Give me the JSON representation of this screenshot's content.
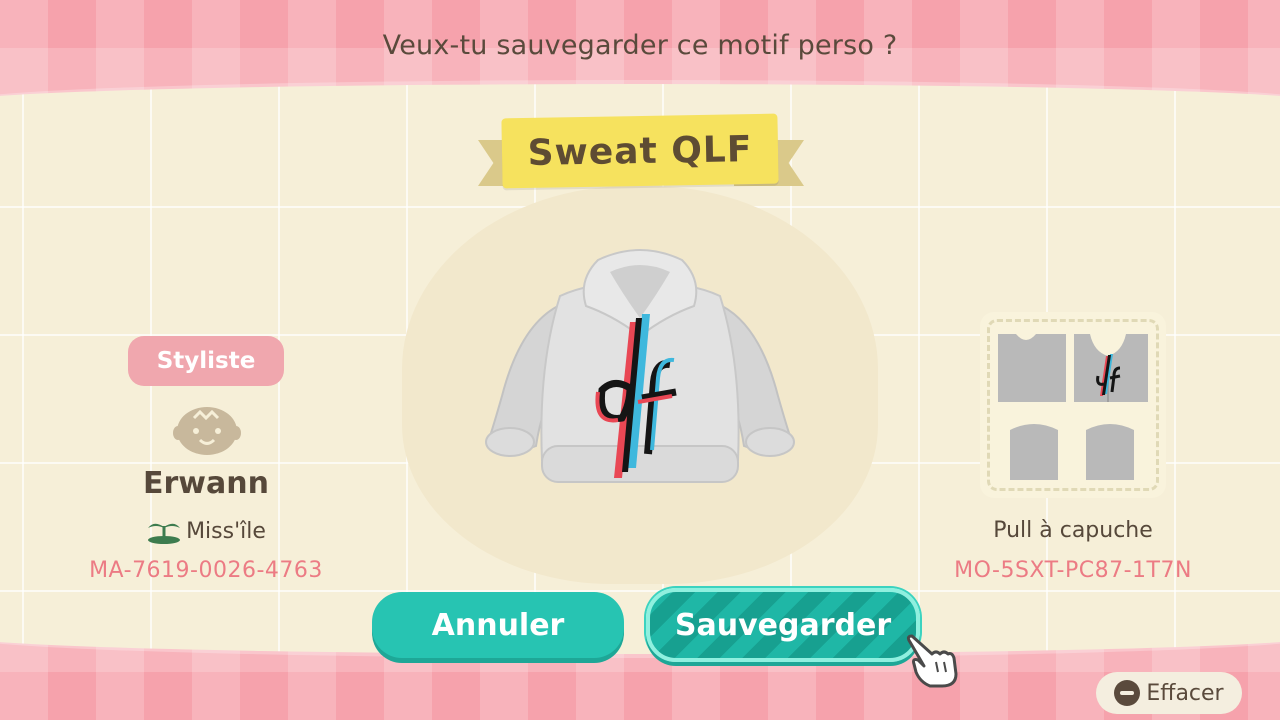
{
  "dialog": {
    "prompt": "Veux-tu sauvegarder ce motif perso ?",
    "design_title": "Sweat QLF"
  },
  "creator": {
    "badge": "Styliste",
    "name": "Erwann",
    "island": "Miss'île",
    "code": "MA-7619-0026-4763"
  },
  "design": {
    "type": "Pull à capuche",
    "code": "MO-5SXT-PC87-1T7N",
    "logo_text": "qlf"
  },
  "buttons": {
    "cancel": "Annuler",
    "save": "Sauvegarder",
    "clear": "Effacer"
  },
  "colors": {
    "accent_teal": "#27c4b2",
    "code_pink": "#ec7b84",
    "ribbon_yellow": "#f6e25e"
  }
}
